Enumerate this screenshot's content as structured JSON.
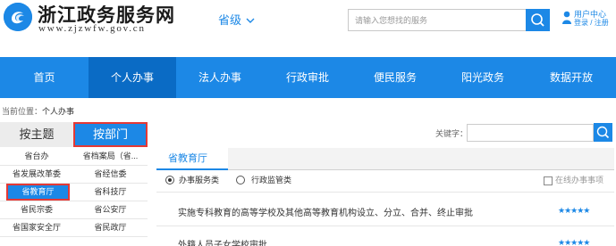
{
  "header": {
    "site_title": "浙江政务服务网",
    "site_url": "www.zjzwfw.gov.cn",
    "region_label": "省级",
    "search_placeholder": "请输入您想找的服务",
    "user_center": "用户中心",
    "login": "登录",
    "separator": "/",
    "register": "注册"
  },
  "nav": {
    "items": [
      {
        "label": "首页",
        "active": false
      },
      {
        "label": "个人办事",
        "active": true
      },
      {
        "label": "法人办事",
        "active": false
      },
      {
        "label": "行政审批",
        "active": false
      },
      {
        "label": "便民服务",
        "active": false
      },
      {
        "label": "阳光政务",
        "active": false
      },
      {
        "label": "数据开放",
        "active": false
      }
    ]
  },
  "breadcrumb": {
    "prefix": "当前位置：",
    "current": "个人办事"
  },
  "left_panel": {
    "tab_theme": "按主题",
    "tab_department": "按部门",
    "departments": [
      [
        "省台办",
        "省档案局（省..."
      ],
      [
        "省发展改革委",
        "省经信委"
      ],
      [
        "省教育厅",
        "省科技厅"
      ],
      [
        "省民宗委",
        "省公安厅"
      ],
      [
        "省国家安全厅",
        "省民政厅"
      ]
    ],
    "selected_department": "省教育厅"
  },
  "right_panel": {
    "keyword_label": "关键字：",
    "keyword_value": "",
    "section_title": "省教育厅",
    "radio_options": [
      "办事服务类",
      "行政监管类"
    ],
    "radio_selected": "办事服务类",
    "online_checkbox_label": "在线办事事项",
    "online_checked": false,
    "items": [
      {
        "title": "实施专科教育的高等学校及其他高等教育机构设立、分立、合并、终止审批",
        "stars": 5
      },
      {
        "title": "外籍人员子女学校审批",
        "stars": 5
      }
    ]
  },
  "colors": {
    "primary": "#1c88e6",
    "nav_active": "#0a6bc5",
    "highlight_border": "#e53935"
  }
}
